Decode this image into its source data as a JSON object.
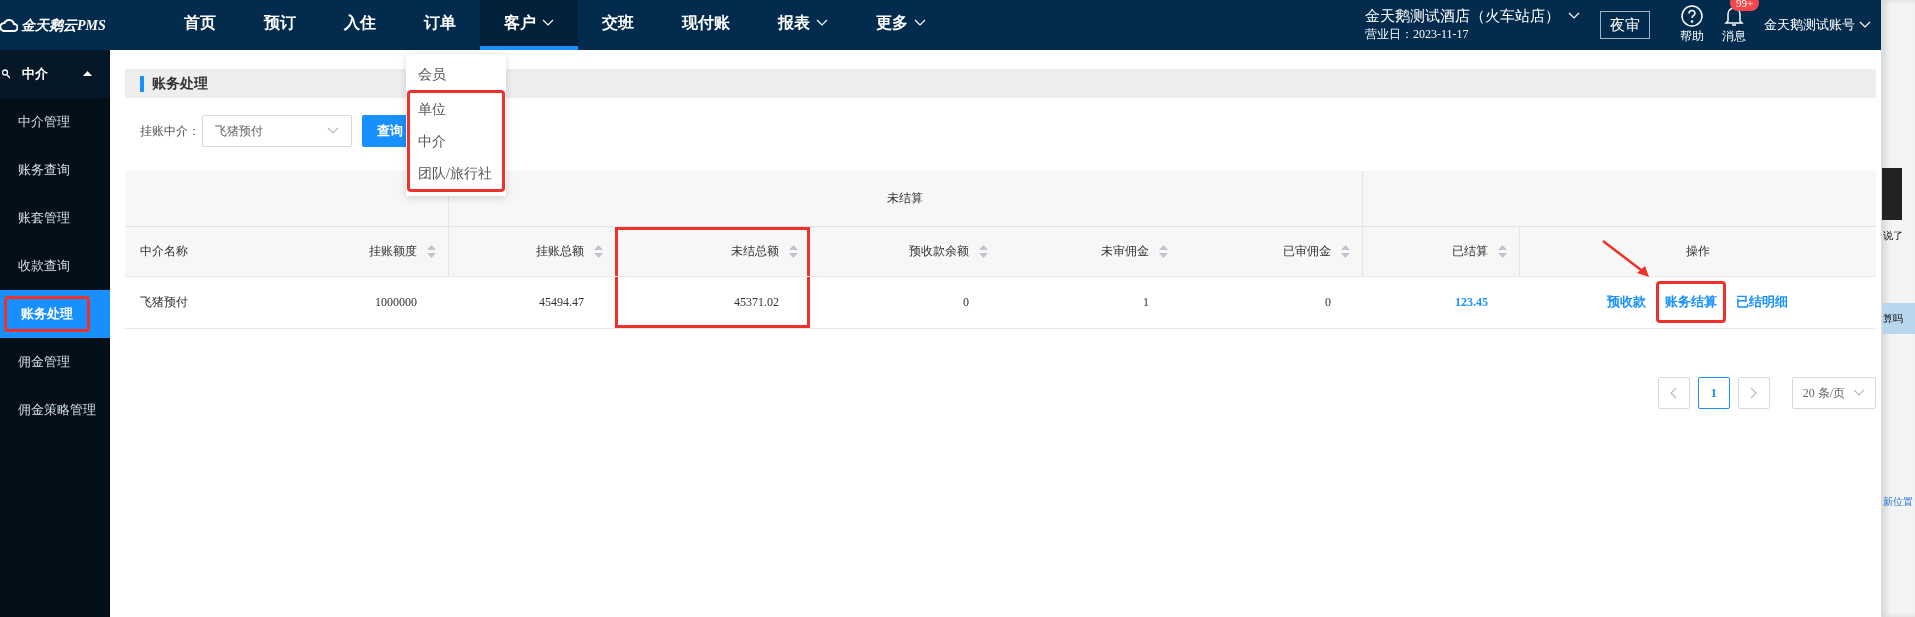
{
  "logo": {
    "text": "金天鹅云PMS"
  },
  "nav": [
    {
      "label": "首页",
      "selected": false,
      "has_menu": false
    },
    {
      "label": "预订",
      "selected": false,
      "has_menu": false
    },
    {
      "label": "入住",
      "selected": false,
      "has_menu": false
    },
    {
      "label": "订单",
      "selected": false,
      "has_menu": false
    },
    {
      "label": "客户",
      "selected": true,
      "has_menu": true
    },
    {
      "label": "交班",
      "selected": false,
      "has_menu": false
    },
    {
      "label": "现付账",
      "selected": false,
      "has_menu": false
    },
    {
      "label": "报表",
      "selected": false,
      "has_menu": true
    },
    {
      "label": "更多",
      "selected": false,
      "has_menu": true
    }
  ],
  "dropdown": [
    {
      "label": "会员",
      "highlighted": false
    },
    {
      "label": "单位",
      "highlighted": true
    },
    {
      "label": "中介",
      "highlighted": true
    },
    {
      "label": "团队/旅行社",
      "highlighted": true
    }
  ],
  "hotel": {
    "name": "金天鹅测试酒店（火车站店）",
    "business_date": "营业日：2023-11-17"
  },
  "night_audit_button": "夜审",
  "help": {
    "label": "帮助"
  },
  "messages": {
    "label": "消息",
    "badge": "99+"
  },
  "account": {
    "name": "金天鹅测试账号"
  },
  "sidebar": {
    "group": {
      "label": "中介",
      "expanded": true
    },
    "items": [
      {
        "label": "中介管理",
        "selected": false,
        "highlighted": false
      },
      {
        "label": "账务查询",
        "selected": false,
        "highlighted": false
      },
      {
        "label": "账套管理",
        "selected": false,
        "highlighted": false
      },
      {
        "label": "收款查询",
        "selected": false,
        "highlighted": false
      },
      {
        "label": "账务处理",
        "selected": true,
        "highlighted": true
      },
      {
        "label": "佣金管理",
        "selected": false,
        "highlighted": false
      },
      {
        "label": "佣金策略管理",
        "selected": false,
        "highlighted": false
      }
    ]
  },
  "page_title": "账务处理",
  "filter": {
    "label": "挂账中介：",
    "value": "飞猪预付",
    "button": "查询"
  },
  "table": {
    "group_header": "未结算",
    "columns": [
      {
        "label": "中介名称",
        "sortable": false,
        "highlighted": false
      },
      {
        "label": "挂账额度",
        "sortable": true,
        "highlighted": false
      },
      {
        "label": "挂账总额",
        "sortable": true,
        "highlighted": false
      },
      {
        "label": "未结总额",
        "sortable": true,
        "highlighted": true
      },
      {
        "label": "预收款余额",
        "sortable": true,
        "highlighted": false
      },
      {
        "label": "未审佣金",
        "sortable": true,
        "highlighted": false
      },
      {
        "label": "已审佣金",
        "sortable": true,
        "highlighted": false
      },
      {
        "label": "已结算",
        "sortable": true,
        "highlighted": false
      },
      {
        "label": "操作",
        "sortable": false,
        "highlighted": false
      }
    ],
    "rows": [
      {
        "cells": [
          "飞猪预付",
          "1000000",
          "45494.47",
          "45371.02",
          "0",
          "1",
          "0",
          "123.45"
        ],
        "actions": [
          {
            "label": "预收款",
            "highlighted": false
          },
          {
            "label": "账务结算",
            "highlighted": true
          },
          {
            "label": "已结明细",
            "highlighted": false
          }
        ]
      }
    ]
  },
  "pagination": {
    "pages": [
      {
        "label": "1",
        "selected": true
      }
    ],
    "page_size": "20 条/页"
  },
  "side_page": {
    "texts": [
      "说了",
      "算吗",
      "新位置"
    ]
  }
}
